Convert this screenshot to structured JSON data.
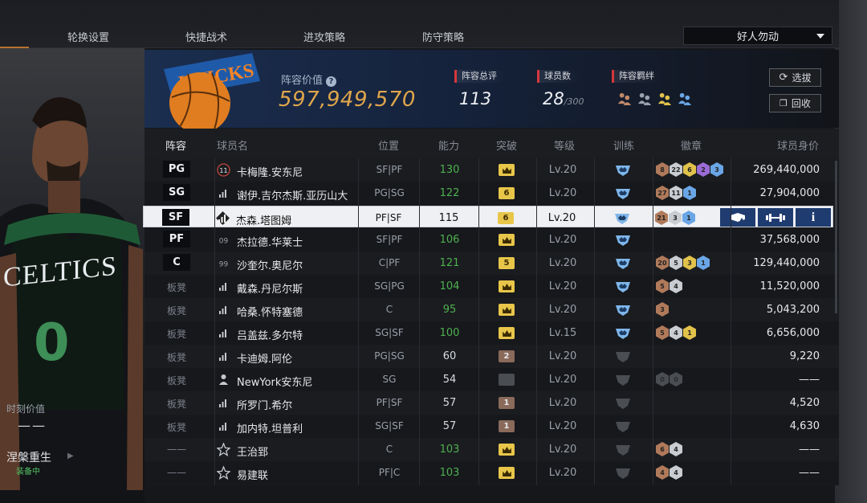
{
  "nav": {
    "tabs": [
      "轮换设置",
      "快捷战术",
      "进攻策略",
      "防守策略"
    ],
    "dropdown_value": "好人勿动"
  },
  "left_panel": {
    "jersey_number": "0",
    "jersey_team": "CELTICS",
    "moment_value_label": "时刻价值",
    "moment_value": "——",
    "skill_name": "涅槃重生",
    "skill_status": "装备中"
  },
  "header": {
    "logo_text": "KNICKS",
    "lineup_value_label": "阵容价值",
    "lineup_value": "597,949,570",
    "overall_label": "阵容总评",
    "overall_value": "113",
    "player_count_label": "球员数",
    "player_count_value": "28",
    "player_count_max": "/300",
    "bonds_label": "阵容羁绊",
    "bond_colors": [
      "#c08a6a",
      "#9aa3ad",
      "#e1c24a",
      "#6aa6e6"
    ],
    "draft_button": "选拔",
    "recycle_button": "回收"
  },
  "table": {
    "headers": [
      "阵容",
      "球员名",
      "位置",
      "能力",
      "突破",
      "等级",
      "训练",
      "徽章",
      "球员身价"
    ],
    "rows": [
      {
        "slot": "PG",
        "starter": true,
        "icon": "number-11",
        "name": "卡梅隆.安东尼",
        "pos": "SF|PF",
        "ability": "130",
        "boost": true,
        "break": "crown",
        "level": "Lv.20",
        "train": "active",
        "badges": [
          {
            "t": "8",
            "c": "#b07a5a"
          },
          {
            "t": "22",
            "c": "#c9ccd1"
          },
          {
            "t": "6",
            "c": "#e1c24a"
          },
          {
            "t": "2",
            "c": "#9b6bd6"
          },
          {
            "t": "3",
            "c": "#6aa6e6"
          }
        ],
        "price": "269,440,000"
      },
      {
        "slot": "SG",
        "starter": true,
        "icon": "signal",
        "name": "谢伊.吉尔杰斯.亚历山大",
        "pos": "PG|SG",
        "ability": "122",
        "boost": true,
        "break": "6",
        "level": "Lv.20",
        "train": "active",
        "badges": [
          {
            "t": "27",
            "c": "#b07a5a"
          },
          {
            "t": "11",
            "c": "#c9ccd1"
          },
          {
            "t": "1",
            "c": "#6aa6e6"
          }
        ],
        "price": "27,904,000"
      },
      {
        "slot": "SF",
        "starter": true,
        "selected": true,
        "icon": "diamond-signal",
        "name": "杰森.塔图姆",
        "pos": "PF|SF",
        "ability": "115",
        "boost": false,
        "break": "6",
        "level": "Lv.20",
        "train": "active",
        "badges": [
          {
            "t": "21",
            "c": "#b07a5a"
          },
          {
            "t": "3",
            "c": "#c9ccd1"
          },
          {
            "t": "1",
            "c": "#6aa6e6"
          }
        ],
        "price": ""
      },
      {
        "slot": "PF",
        "starter": true,
        "icon": "number-09",
        "name": "杰拉德.华莱士",
        "pos": "SF|PF",
        "ability": "106",
        "boost": true,
        "break": "crown",
        "level": "Lv.20",
        "train": "active",
        "badges": [],
        "price": "37,568,000"
      },
      {
        "slot": "C",
        "starter": true,
        "icon": "number-99",
        "name": "沙奎尔.奥尼尔",
        "pos": "C|PF",
        "ability": "121",
        "boost": true,
        "break": "5",
        "level": "Lv.20",
        "train": "active",
        "badges": [
          {
            "t": "20",
            "c": "#b07a5a"
          },
          {
            "t": "5",
            "c": "#c9ccd1"
          },
          {
            "t": "3",
            "c": "#e1c24a"
          },
          {
            "t": "1",
            "c": "#6aa6e6"
          }
        ],
        "price": "129,440,000"
      },
      {
        "slot": "板凳",
        "starter": false,
        "icon": "signal",
        "name": "戴森.丹尼尔斯",
        "pos": "SG|PG",
        "ability": "104",
        "boost": true,
        "break": "crown",
        "level": "Lv.20",
        "train": "active",
        "badges": [
          {
            "t": "5",
            "c": "#b07a5a"
          },
          {
            "t": "4",
            "c": "#c9ccd1"
          }
        ],
        "price": "11,520,000"
      },
      {
        "slot": "板凳",
        "starter": false,
        "icon": "signal",
        "name": "哈桑.怀特塞德",
        "pos": "C",
        "ability": "95",
        "boost": true,
        "break": "crown",
        "level": "Lv.20",
        "train": "active",
        "badges": [
          {
            "t": "3",
            "c": "#b07a5a"
          }
        ],
        "price": "5,043,200"
      },
      {
        "slot": "板凳",
        "starter": false,
        "icon": "signal",
        "name": "吕盖兹.多尔特",
        "pos": "SG|SF",
        "ability": "100",
        "boost": true,
        "break": "crown",
        "level": "Lv.15",
        "train": "active",
        "badges": [
          {
            "t": "5",
            "c": "#b07a5a"
          },
          {
            "t": "4",
            "c": "#c9ccd1"
          },
          {
            "t": "1",
            "c": "#e1c24a"
          }
        ],
        "price": "6,656,000"
      },
      {
        "slot": "板凳",
        "starter": false,
        "icon": "signal",
        "name": "卡迪姆.阿伦",
        "pos": "PG|SG",
        "ability": "60",
        "boost": false,
        "break": "2",
        "level": "Lv.20",
        "train": "inactive",
        "badges": [],
        "price": "9,220"
      },
      {
        "slot": "板凳",
        "starter": false,
        "icon": "person",
        "name": "NewYork安东尼",
        "pos": "SG",
        "ability": "54",
        "boost": false,
        "break": "none",
        "level": "Lv.20",
        "train": "inactive",
        "badges": [
          {
            "t": "0",
            "c": "#4a4d52"
          },
          {
            "t": "0",
            "c": "#4a4d52"
          }
        ],
        "price": "——"
      },
      {
        "slot": "板凳",
        "starter": false,
        "icon": "signal",
        "name": "所罗门.希尔",
        "pos": "PF|SF",
        "ability": "57",
        "boost": false,
        "break": "1",
        "level": "Lv.20",
        "train": "inactive",
        "badges": [],
        "price": "4,520"
      },
      {
        "slot": "板凳",
        "starter": false,
        "icon": "signal",
        "name": "加内特.坦普利",
        "pos": "SG|SF",
        "ability": "57",
        "boost": false,
        "break": "1",
        "level": "Lv.20",
        "train": "inactive",
        "badges": [],
        "price": "4,630"
      },
      {
        "slot": "——",
        "starter": false,
        "icon": "star",
        "name": "王治郅",
        "pos": "C",
        "ability": "103",
        "boost": true,
        "break": "crown",
        "level": "Lv.20",
        "train": "inactive",
        "badges": [
          {
            "t": "6",
            "c": "#b07a5a"
          },
          {
            "t": "4",
            "c": "#c9ccd1"
          }
        ],
        "price": "——"
      },
      {
        "slot": "——",
        "starter": false,
        "icon": "star",
        "name": "易建联",
        "pos": "PF|C",
        "ability": "103",
        "boost": true,
        "break": "crown",
        "level": "Lv.20",
        "train": "inactive",
        "badges": [
          {
            "t": "4",
            "c": "#b07a5a"
          },
          {
            "t": "4",
            "c": "#c9ccd1"
          }
        ],
        "price": "——"
      }
    ]
  },
  "colors": {
    "accent_gold": "#e0a64b",
    "ability_up": "#4fb04f",
    "action_blue": "#1f3c70"
  }
}
